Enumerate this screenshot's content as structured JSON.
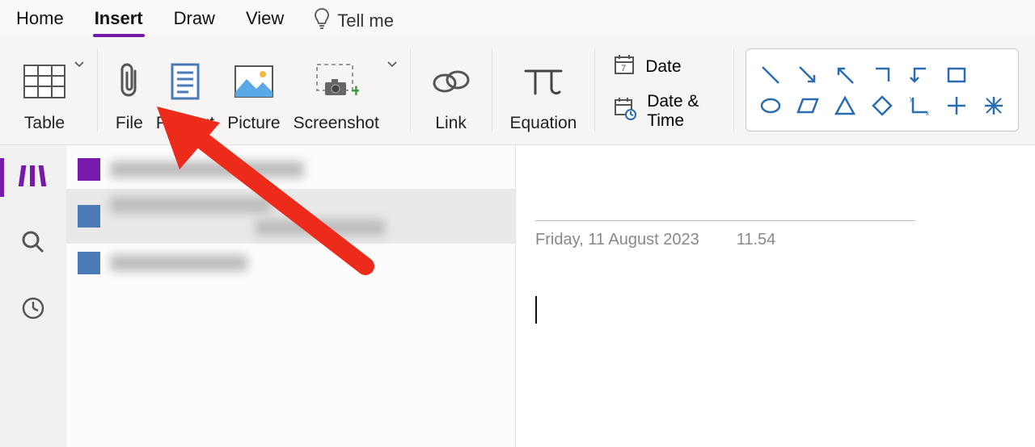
{
  "tabs": {
    "home": "Home",
    "insert": "Insert",
    "draw": "Draw",
    "view": "View",
    "tellme": "Tell me"
  },
  "ribbon": {
    "table": "Table",
    "file": "File",
    "printout": "Printout",
    "picture": "Picture",
    "screenshot": "Screenshot",
    "link": "Link",
    "equation": "Equation",
    "date": "Date",
    "datetime": "Date & Time"
  },
  "page": {
    "date": "Friday, 11 August 2023",
    "time": "11.54"
  },
  "colors": {
    "accent": "#7719aa",
    "shape": "#2b6cb0"
  }
}
